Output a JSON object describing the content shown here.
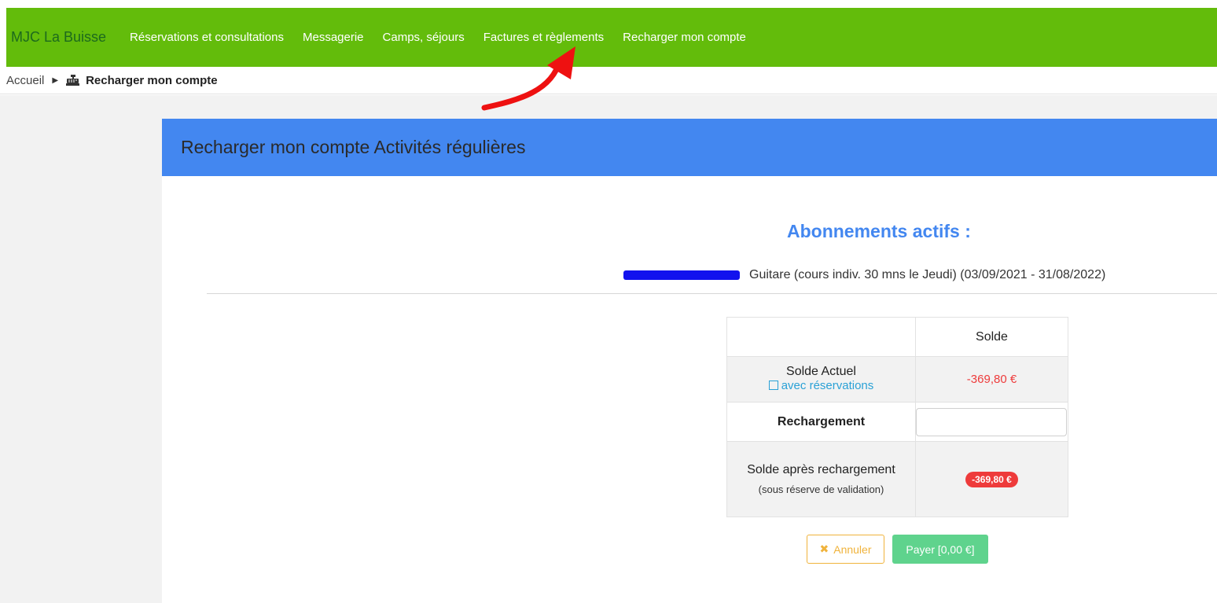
{
  "navbar": {
    "brand": "MJC La Buisse",
    "items": [
      {
        "label": "Réservations et consultations"
      },
      {
        "label": "Messagerie"
      },
      {
        "label": "Camps, séjours"
      },
      {
        "label": "Factures et règlements"
      },
      {
        "label": "Recharger mon compte"
      }
    ],
    "color": "#63bc0b"
  },
  "breadcrumb": {
    "home": "Accueil",
    "current": "Recharger mon compte",
    "current_icon": "cash-register-icon"
  },
  "panel": {
    "title": "Recharger mon compte Activités régulières",
    "header_color": "#4387f0"
  },
  "subscriptions": {
    "title": "Abonnements actifs :",
    "items": [
      {
        "text": "Guitare (cours indiv. 30 mns le Jeudi) (03/09/2021 - 31/08/2022)"
      }
    ]
  },
  "solde_table": {
    "header": "Solde",
    "actuel_label": "Solde Actuel",
    "avec_reservations": "avec réservations",
    "actuel_value": "-369,80 €",
    "recharge_label": "Rechargement",
    "recharge_value": "",
    "apres_label": "Solde après rechargement",
    "apres_note": "(sous réserve de validation)",
    "apres_value": "-369,80 €"
  },
  "buttons": {
    "cancel": "Annuler",
    "pay": "Payer [0,00 €]"
  },
  "annotation": {
    "arrow_color": "#ee1111"
  }
}
